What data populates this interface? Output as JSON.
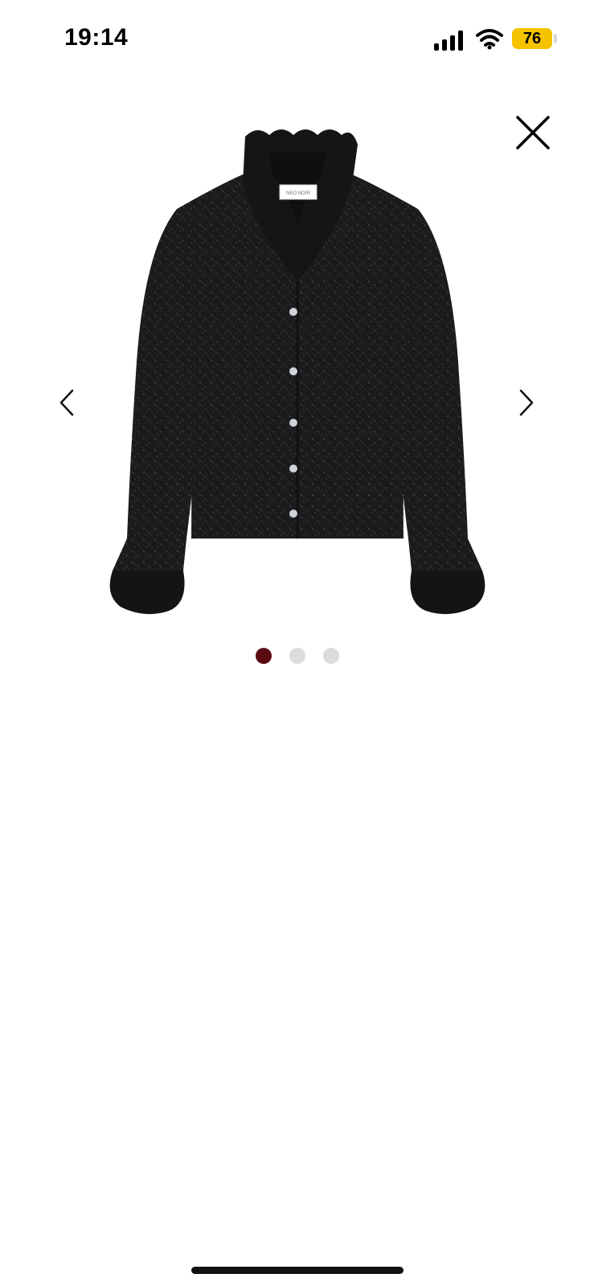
{
  "status_bar": {
    "time": "19:14",
    "battery_level": "76",
    "battery_color": "#f5c300",
    "icons": [
      "signal-icon",
      "wifi-icon",
      "battery-icon"
    ]
  },
  "viewer": {
    "close_icon": "close-icon",
    "prev_icon": "chevron-left-icon",
    "next_icon": "chevron-right-icon",
    "image": {
      "subject": "black long-sleeve ruffle-collar sparkle blouse",
      "label_text": "NEO NOIR"
    },
    "pagination": {
      "total": 3,
      "active_index": 0,
      "active_color": "#5a0a12",
      "inactive_color": "#dcdcdc"
    }
  }
}
